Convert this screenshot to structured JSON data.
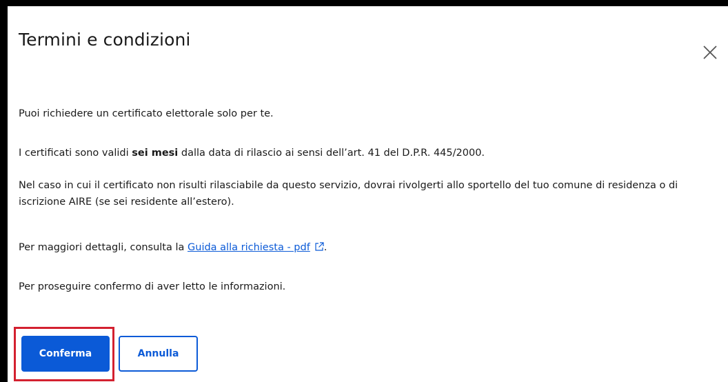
{
  "dialog": {
    "title": "Termini e condizioni",
    "close_label": "×"
  },
  "content": {
    "p1": "Puoi richiedere un certificato elettorale solo per te.",
    "p2_before": "I certificati sono validi ",
    "p2_bold": "sei mesi",
    "p2_after": " dalla data di rilascio ai sensi dell’art. 41 del D.P.R. 445/2000.",
    "p3": "Nel caso in cui il certificato non risulti rilasciabile da questo servizio, dovrai rivolgerti allo sportello del tuo comune di residenza o di iscrizione AIRE (se sei residente all’estero).",
    "p4_before": "Per maggiori dettagli, consulta la ",
    "p4_link": "Guida alla richiesta - pdf",
    "p4_after": ".",
    "p5": "Per proseguire confermo di aver letto le informazioni."
  },
  "actions": {
    "confirm_label": "Conferma",
    "cancel_label": "Annulla"
  },
  "icons": {
    "close": "close-icon",
    "external_link": "external-link-icon"
  },
  "colors": {
    "primary": "#0b5ad7",
    "highlight": "#d3202f",
    "text": "#1a1a1a"
  }
}
